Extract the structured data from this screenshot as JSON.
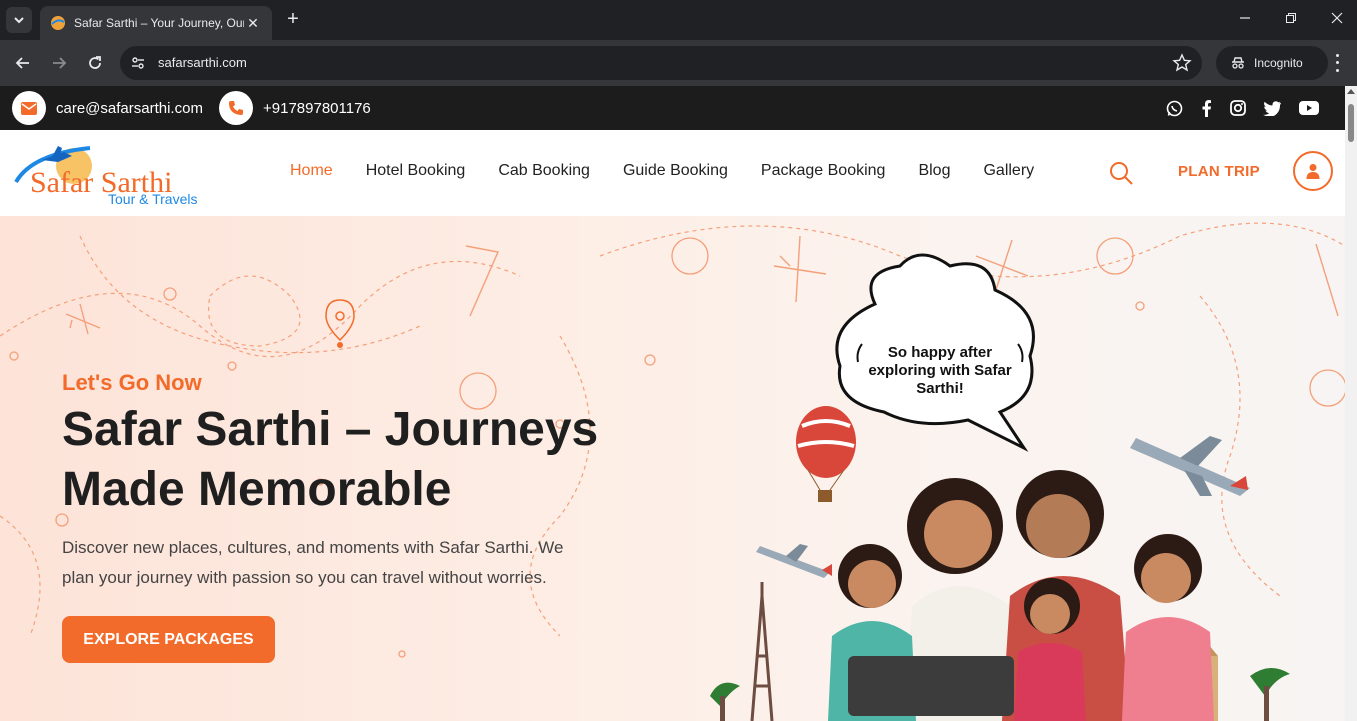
{
  "browser": {
    "tab_title": "Safar Sarthi – Your Journey, Our",
    "url": "safarsarthi.com",
    "incognito_label": "Incognito"
  },
  "topbar": {
    "email": "care@safarsarthi.com",
    "phone": "+917897801176",
    "socials": [
      "whatsapp-icon",
      "facebook-icon",
      "instagram-icon",
      "twitter-icon",
      "youtube-icon"
    ]
  },
  "logo": {
    "name": "Safar Sarthi",
    "tagline": "Tour & Travels"
  },
  "nav": {
    "items": [
      {
        "label": "Home",
        "active": true
      },
      {
        "label": "Hotel Booking"
      },
      {
        "label": "Cab Booking"
      },
      {
        "label": "Guide Booking"
      },
      {
        "label": "Package Booking"
      },
      {
        "label": "Blog"
      },
      {
        "label": "Gallery"
      }
    ],
    "plan_trip": "PLAN TRIP"
  },
  "hero": {
    "kicker": "Let's Go Now",
    "title": "Safar Sarthi – Journeys Made Memorable",
    "description": "Discover new places, cultures, and moments with Safar Sarthi. We plan your journey with passion so you can travel without worries.",
    "cta": "EXPLORE PACKAGES",
    "bubble": "So happy after exploring with Safar Sarthi!"
  },
  "colors": {
    "accent": "#f26b2a",
    "topbar": "#1c1c1c",
    "chrome": "#202124"
  }
}
